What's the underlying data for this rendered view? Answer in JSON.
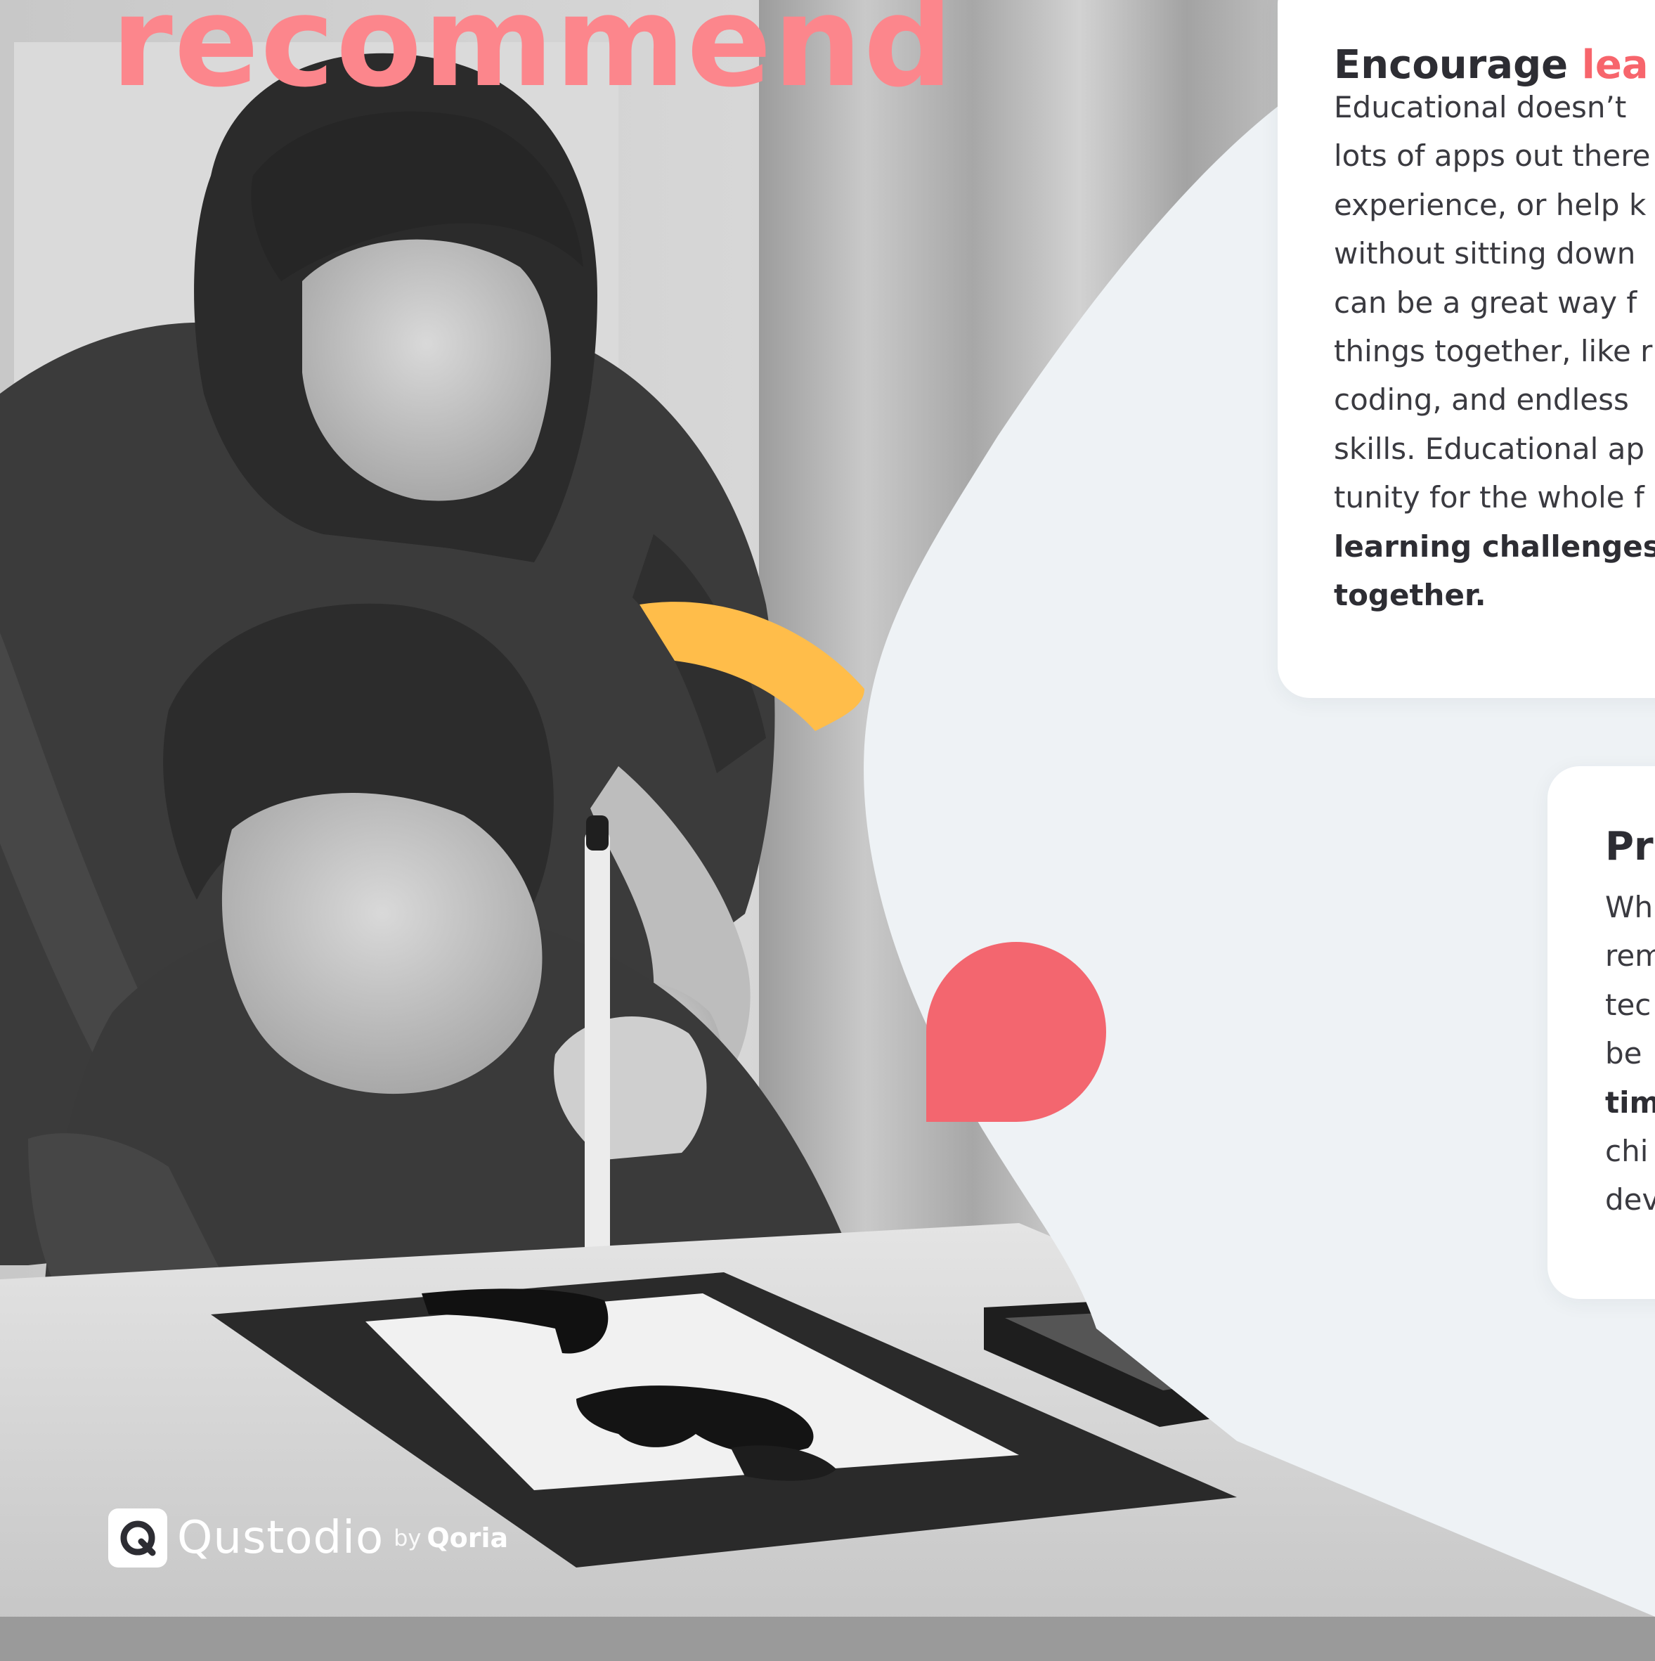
{
  "headline": {
    "word": "recommend"
  },
  "colors": {
    "accent": "#f7656c",
    "heading_pink": "#fc868c",
    "yellow": "#ffbd4a",
    "coral": "#f3666f",
    "panel_bg": "#eef2f5",
    "text_dark": "#2d2d33"
  },
  "cards": [
    {
      "title_plain": "Encourage ",
      "title_accent": "lea",
      "lines": [
        "Educational doesn’t",
        "lots of apps out there",
        "experience, or help k",
        "without sitting down",
        "can be a great way f",
        "things together, like r",
        "coding, and endless",
        "skills. Educational ap",
        "tunity for the whole f"
      ],
      "bold_lines": [
        "learning challenges",
        "together."
      ]
    },
    {
      "title_plain": "Pri",
      "lines": [
        "Wh",
        "rem",
        "tec",
        "be"
      ],
      "bold_line": "tim",
      "lines_after": [
        "chi",
        "dev"
      ]
    }
  ],
  "brand": {
    "name": "Qustodio",
    "by": "by",
    "parent": "Qoria",
    "icon": "qustodio-logo-icon"
  }
}
